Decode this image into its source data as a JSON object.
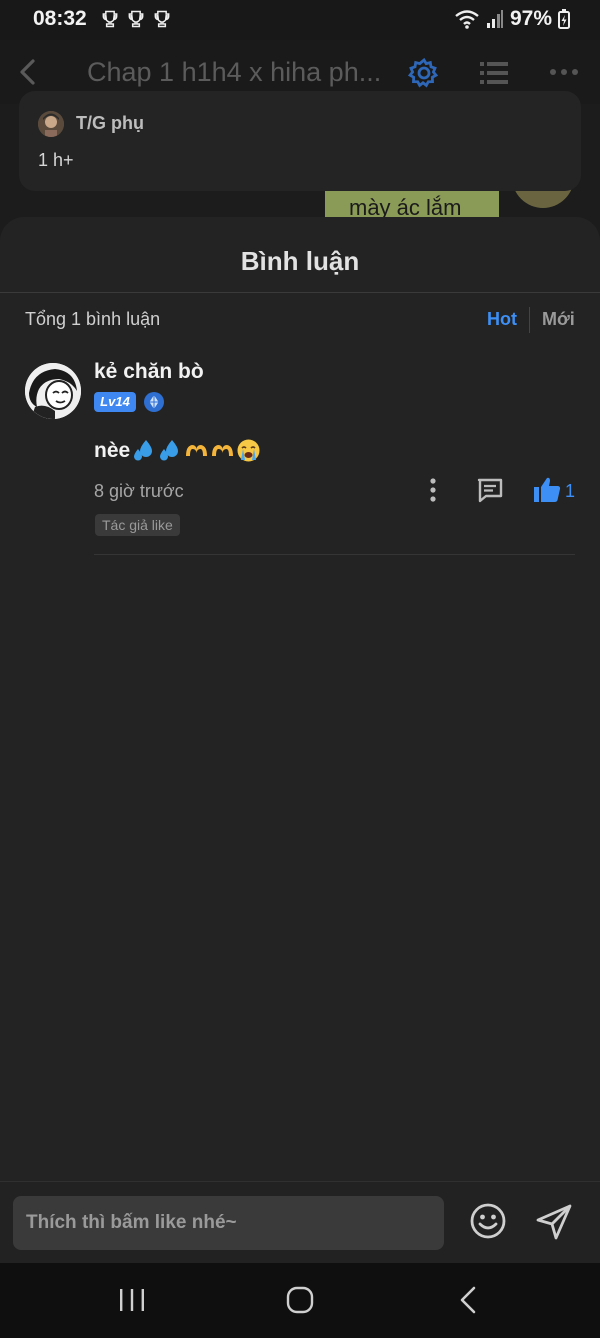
{
  "status_bar": {
    "time": "08:32",
    "battery": "97%",
    "trophy_icons": [
      "trophy-icon",
      "trophy-icon",
      "trophy-icon"
    ]
  },
  "top_bar": {
    "title": "Chap 1 h1h4 x hiha ph...",
    "icons": [
      "back-arrow-icon",
      "gear-icon",
      "list-icon",
      "more-dots-icon"
    ],
    "accent_color": "#3d8ff5"
  },
  "author_note": {
    "name": "T/G phụ",
    "text": "1 h+"
  },
  "background_peek": {
    "text": "mày ác lắm"
  },
  "comments_sheet": {
    "title": "Bình luận",
    "total": "Tổng 1 bình luận",
    "sort_hot": "Hot",
    "sort_new": "Mới",
    "active_sort": "Hot",
    "comments": [
      {
        "username": "kẻ chăn bò",
        "level": "Lv14",
        "text": "nèe",
        "emojis": [
          "sweat-droplets-emoji",
          "sweat-droplets-emoji",
          "heart-hands-emoji",
          "heart-hands-emoji",
          "loudly-crying-face-emoji"
        ],
        "time": "8 giờ trước",
        "likes": "1",
        "tag": "Tác giả like"
      }
    ]
  },
  "input_bar": {
    "placeholder": "Thích thì bấm like nhé~"
  },
  "colors": {
    "background": "#1c1c1c",
    "sheet": "#232323",
    "accent_blue": "#3d8ff5",
    "muted_text": "#a6a6a6"
  }
}
